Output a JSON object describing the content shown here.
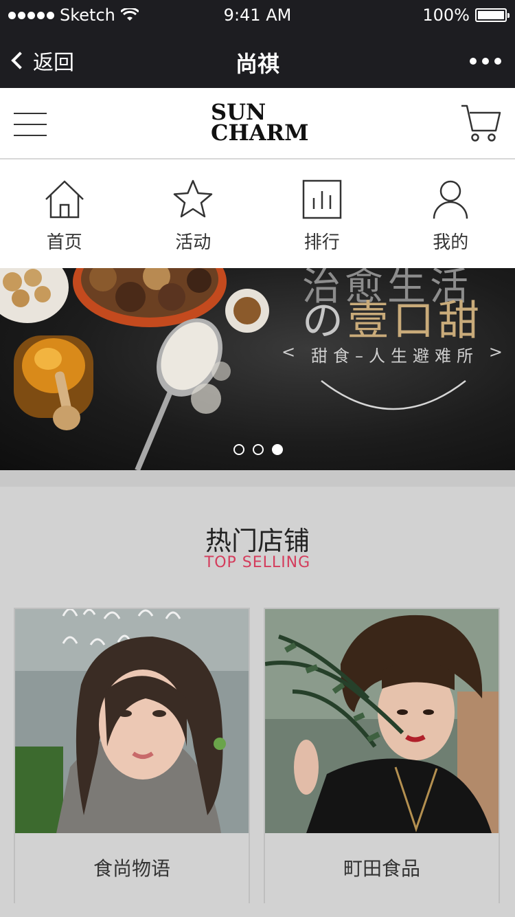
{
  "status": {
    "carrier": "Sketch",
    "time": "9:41 AM",
    "battery": "100%"
  },
  "nav": {
    "back": "返回",
    "title": "尚祺"
  },
  "header": {
    "logo_line1": "SUN",
    "logo_line2": "CHARM"
  },
  "quicknav": [
    {
      "label": "首页",
      "icon": "home-icon"
    },
    {
      "label": "活动",
      "icon": "star-icon"
    },
    {
      "label": "排行",
      "icon": "chart-icon"
    },
    {
      "label": "我的",
      "icon": "user-icon"
    }
  ],
  "banner": {
    "top_text": "治愈生活",
    "main_prefix": "の",
    "main_highlight": "壹口甜",
    "subtitle_left": "<",
    "subtitle": "甜食–人生避难所",
    "subtitle_right": ">",
    "active_slide": 3,
    "slide_count": 3
  },
  "section": {
    "title": "热门店铺",
    "subtitle": "TOP SELLING"
  },
  "shops": [
    {
      "name": "食尚物语"
    },
    {
      "name": "町田食品"
    }
  ],
  "colors": {
    "bar": "#1d1d21",
    "accent": "#d43c5c",
    "gold": "#c9ab7a"
  }
}
